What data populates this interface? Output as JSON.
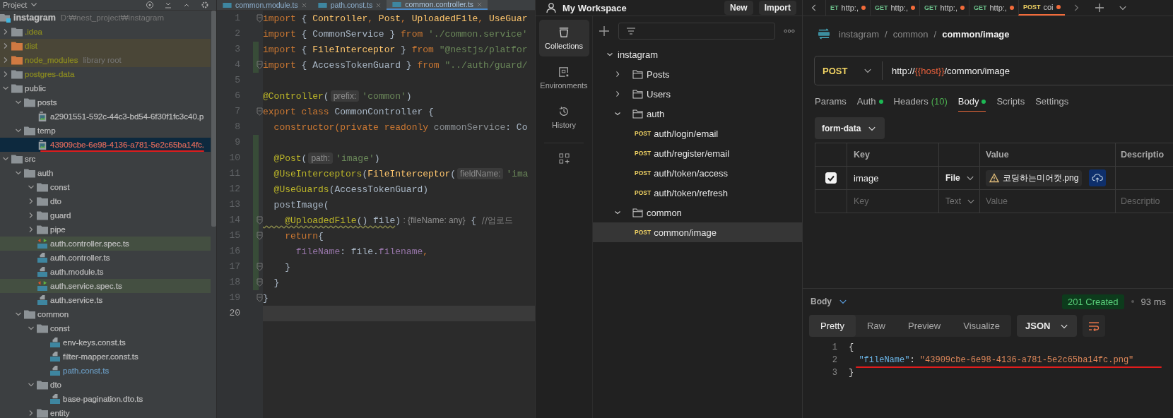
{
  "ide": {
    "project_header": {
      "title": "Project"
    },
    "tree": [
      {
        "name": "instagram",
        "hint": "D:₩nest_project₩instagram",
        "kind": "root",
        "color": "#bbbbbb",
        "selected": false,
        "children": [
          {
            "name": ".idea",
            "kind": "folder",
            "expanded": false,
            "color": "#8b8b21",
            "selected": false
          },
          {
            "name": "dist",
            "kind": "excluded-folder",
            "expanded": false,
            "color": "#8b8b21",
            "selected": false
          },
          {
            "name": "node_modules",
            "hint": "library root",
            "kind": "excluded-folder",
            "expanded": false,
            "color": "#8b8b21",
            "selected": false
          },
          {
            "name": "postgres-data",
            "kind": "folder",
            "expanded": false,
            "color": "#8b8b21",
            "selected": false
          },
          {
            "name": "public",
            "kind": "folder",
            "expanded": true,
            "color": "#bbbbbb",
            "selected": false,
            "children": [
              {
                "name": "posts",
                "kind": "folder",
                "expanded": true,
                "color": "#bbbbbb",
                "selected": false,
                "children": [
                  {
                    "name": "a2901551-592c-44c3-bd54-6f30f1fc3c40.p",
                    "kind": "image-file",
                    "color": "#bbbbbb",
                    "selected": false
                  }
                ]
              },
              {
                "name": "temp",
                "kind": "folder",
                "expanded": true,
                "color": "#bbbbbb",
                "selected": false,
                "children": [
                  {
                    "name": "43909cbe-6e98-4136-a781-5e2c65ba14fc.",
                    "kind": "image-file",
                    "color": "#d8695b",
                    "selected": true,
                    "underlined": true
                  }
                ]
              }
            ]
          },
          {
            "name": "src",
            "kind": "folder",
            "expanded": true,
            "color": "#bbbbbb",
            "selected": false,
            "children": [
              {
                "name": "auth",
                "kind": "folder",
                "expanded": true,
                "color": "#bbbbbb",
                "selected": false,
                "children": [
                  {
                    "name": "const",
                    "kind": "folder",
                    "expanded": true,
                    "color": "#bbbbbb",
                    "selected": false
                  },
                  {
                    "name": "dto",
                    "kind": "folder",
                    "expanded": false,
                    "color": "#bbbbbb",
                    "selected": false
                  },
                  {
                    "name": "guard",
                    "kind": "folder",
                    "expanded": false,
                    "color": "#bbbbbb",
                    "selected": false
                  },
                  {
                    "name": "pipe",
                    "kind": "folder",
                    "expanded": false,
                    "color": "#bbbbbb",
                    "selected": false
                  },
                  {
                    "name": "auth.controller.spec.ts",
                    "kind": "test-file",
                    "color": "#bbbbbb",
                    "selected": false
                  },
                  {
                    "name": "auth.controller.ts",
                    "kind": "ts-file",
                    "color": "#bbbbbb",
                    "selected": false
                  },
                  {
                    "name": "auth.module.ts",
                    "kind": "ts-file",
                    "color": "#bbbbbb",
                    "selected": false
                  },
                  {
                    "name": "auth.service.spec.ts",
                    "kind": "test-file",
                    "color": "#bbbbbb",
                    "selected": false
                  },
                  {
                    "name": "auth.service.ts",
                    "kind": "ts-file",
                    "color": "#bbbbbb",
                    "selected": false
                  }
                ]
              },
              {
                "name": "common",
                "kind": "folder",
                "expanded": true,
                "color": "#bbbbbb",
                "selected": false,
                "children": [
                  {
                    "name": "const",
                    "kind": "folder",
                    "expanded": true,
                    "color": "#bbbbbb",
                    "selected": false,
                    "children": [
                      {
                        "name": "env-keys.const.ts",
                        "kind": "ts-file",
                        "color": "#bbbbbb",
                        "selected": false
                      },
                      {
                        "name": "filter-mapper.const.ts",
                        "kind": "ts-file",
                        "color": "#bbbbbb",
                        "selected": false
                      },
                      {
                        "name": "path.const.ts",
                        "kind": "ts-file",
                        "color": "#6897bb",
                        "selected": false
                      }
                    ]
                  },
                  {
                    "name": "dto",
                    "kind": "folder",
                    "expanded": true,
                    "color": "#bbbbbb",
                    "selected": false,
                    "children": [
                      {
                        "name": "base-pagination.dto.ts",
                        "kind": "ts-file",
                        "color": "#bbbbbb",
                        "selected": false
                      }
                    ]
                  },
                  {
                    "name": "entity",
                    "kind": "folder",
                    "expanded": false,
                    "color": "#bbbbbb",
                    "selected": false
                  }
                ]
              }
            ]
          }
        ]
      }
    ],
    "editor_tabs": [
      {
        "label": "common.module.ts",
        "selected": false
      },
      {
        "label": "path.const.ts",
        "selected": false
      },
      {
        "label": "common.controller.ts",
        "selected": true
      }
    ],
    "code_lines": [
      {
        "number": "1",
        "changed": false,
        "fold": true,
        "current": false,
        "tokens": [
          {
            "text": "import",
            "kind": "kw"
          },
          {
            "text": " { ",
            "kind": "name"
          },
          {
            "text": "Controller",
            "kind": "fn"
          },
          {
            "text": ", ",
            "kind": "kw"
          },
          {
            "text": "Post",
            "kind": "fn"
          },
          {
            "text": ", ",
            "kind": "kw"
          },
          {
            "text": "UploadedFile",
            "kind": "fn"
          },
          {
            "text": ", ",
            "kind": "kw"
          },
          {
            "text": "UseGuar",
            "kind": "fn"
          }
        ]
      },
      {
        "number": "2",
        "changed": false,
        "fold": false,
        "current": false,
        "tokens": [
          {
            "text": "import",
            "kind": "kw"
          },
          {
            "text": " { CommonService } ",
            "kind": "name"
          },
          {
            "text": "from",
            "kind": "kw"
          },
          {
            "text": " './common.service'",
            "kind": "str"
          }
        ]
      },
      {
        "number": "3",
        "changed": true,
        "fold": false,
        "current": false,
        "tokens": [
          {
            "text": "import",
            "kind": "kw"
          },
          {
            "text": " { ",
            "kind": "name"
          },
          {
            "text": "FileInterceptor",
            "kind": "fn"
          },
          {
            "text": " } ",
            "kind": "name"
          },
          {
            "text": "from",
            "kind": "kw"
          },
          {
            "text": " \"@nestjs/platfor",
            "kind": "str"
          }
        ]
      },
      {
        "number": "4",
        "changed": true,
        "fold": true,
        "current": false,
        "tokens": [
          {
            "text": "import",
            "kind": "kw"
          },
          {
            "text": " { AccessTokenGuard } ",
            "kind": "name"
          },
          {
            "text": "from",
            "kind": "kw"
          },
          {
            "text": " \"../auth/guard/",
            "kind": "str"
          }
        ]
      },
      {
        "number": "5",
        "changed": false,
        "fold": false,
        "current": false
      },
      {
        "number": "6",
        "changed": false,
        "fold": false,
        "current": false,
        "tokens": [
          {
            "text": "@Controller",
            "kind": "deco"
          },
          {
            "text": "(",
            "kind": "name"
          },
          {
            "text": "prefix:",
            "kind": "hint"
          },
          {
            "text": "'common'",
            "kind": "str"
          },
          {
            "text": ")",
            "kind": "name"
          }
        ]
      },
      {
        "number": "7",
        "changed": false,
        "fold": true,
        "current": false,
        "tokens": [
          {
            "text": "export class",
            "kind": "kw"
          },
          {
            "text": " CommonController {",
            "kind": "name"
          }
        ]
      },
      {
        "number": "8",
        "changed": false,
        "fold": false,
        "current": false,
        "tokens": [
          {
            "text": "  constructor(private readonly ",
            "kind": "kw"
          },
          {
            "text": "commonService",
            "kind": "unused"
          },
          {
            "text": ": Co",
            "kind": "name"
          }
        ]
      },
      {
        "number": "9",
        "changed": true,
        "fold": false,
        "current": false
      },
      {
        "number": "10",
        "changed": true,
        "fold": false,
        "current": false,
        "tokens": [
          {
            "text": "  @Post",
            "kind": "deco"
          },
          {
            "text": "(",
            "kind": "name"
          },
          {
            "text": "path:",
            "kind": "hint"
          },
          {
            "text": "'image'",
            "kind": "str"
          },
          {
            "text": ")",
            "kind": "name"
          }
        ]
      },
      {
        "number": "11",
        "changed": true,
        "fold": false,
        "current": false,
        "tokens": [
          {
            "text": "  @UseInterceptors",
            "kind": "deco"
          },
          {
            "text": "(",
            "kind": "name"
          },
          {
            "text": "FileInterceptor",
            "kind": "fn"
          },
          {
            "text": "(",
            "kind": "name"
          },
          {
            "text": "fieldName:",
            "kind": "hint"
          },
          {
            "text": "'ima",
            "kind": "str"
          }
        ]
      },
      {
        "number": "12",
        "changed": true,
        "fold": false,
        "current": false,
        "tokens": [
          {
            "text": "  @UseGuards",
            "kind": "deco"
          },
          {
            "text": "(AccessTokenGuard)",
            "kind": "name"
          }
        ]
      },
      {
        "number": "13",
        "changed": true,
        "fold": false,
        "current": false,
        "tokens": [
          {
            "text": "  postImage(",
            "kind": "name"
          }
        ]
      },
      {
        "number": "14",
        "changed": true,
        "fold": true,
        "current": false,
        "tokens": [
          {
            "text": "    @UploadedFile",
            "kind": "deco",
            "squiggly": true
          },
          {
            "text": "() file",
            "kind": "name",
            "squiggly": true
          },
          {
            "text": ")",
            "kind": "name"
          },
          {
            "text": " : {fileName: any}",
            "kind": "note"
          },
          {
            "text": " { ",
            "kind": "name"
          },
          {
            "text": "//업로드",
            "kind": "comment"
          }
        ]
      },
      {
        "number": "15",
        "changed": true,
        "fold": true,
        "current": false,
        "tokens": [
          {
            "text": "    return",
            "kind": "kw"
          },
          {
            "text": "{",
            "kind": "name"
          }
        ]
      },
      {
        "number": "16",
        "changed": true,
        "fold": false,
        "current": false,
        "tokens": [
          {
            "text": "      fileName",
            "kind": "prop"
          },
          {
            "text": ": file.",
            "kind": "name"
          },
          {
            "text": "filename",
            "kind": "prop"
          },
          {
            "text": ",",
            "kind": "kw"
          }
        ]
      },
      {
        "number": "17",
        "changed": true,
        "fold": true,
        "current": false,
        "tokens": [
          {
            "text": "    }",
            "kind": "name"
          }
        ]
      },
      {
        "number": "18",
        "changed": true,
        "fold": true,
        "current": false,
        "tokens": [
          {
            "text": "  }",
            "kind": "name"
          }
        ]
      },
      {
        "number": "19",
        "changed": false,
        "fold": true,
        "current": false,
        "tokens": [
          {
            "text": "}",
            "kind": "name"
          }
        ]
      },
      {
        "number": "20",
        "changed": false,
        "fold": false,
        "current": true
      }
    ]
  },
  "postman": {
    "workspace": {
      "title": "My Workspace",
      "buttons": [
        "New",
        "Import"
      ]
    },
    "rail": [
      {
        "label": "Collections",
        "kind": "collections",
        "selected": true
      },
      {
        "label": "Environments",
        "kind": "environments",
        "selected": false
      },
      {
        "label": "History",
        "kind": "history",
        "selected": false
      }
    ],
    "collections": [
      {
        "name": "instagram",
        "kind": "collection",
        "expanded": true,
        "selected": false,
        "children": [
          {
            "name": "Posts",
            "kind": "folder",
            "expanded": false,
            "selected": false
          },
          {
            "name": "Users",
            "kind": "folder",
            "expanded": false,
            "selected": false
          },
          {
            "name": "auth",
            "kind": "folder",
            "expanded": true,
            "selected": false,
            "children": [
              {
                "name": "auth/login/email",
                "kind": "post-request",
                "method": "POST",
                "selected": false
              },
              {
                "name": "auth/register/email",
                "kind": "post-request",
                "method": "POST",
                "selected": false
              },
              {
                "name": "auth/token/access",
                "kind": "post-request",
                "method": "POST",
                "selected": false
              },
              {
                "name": "auth/token/refresh",
                "kind": "post-request",
                "method": "POST",
                "selected": false
              }
            ]
          },
          {
            "name": "common",
            "kind": "folder",
            "expanded": true,
            "selected": false,
            "children": [
              {
                "name": "common/image",
                "kind": "post-request",
                "method": "POST",
                "selected": true
              }
            ]
          }
        ]
      }
    ],
    "tabs": [
      {
        "method": "ET",
        "kind": "get",
        "label": "http:,",
        "unsaved": true,
        "selected": false
      },
      {
        "method": "GET",
        "kind": "get",
        "label": "http:,",
        "unsaved": true,
        "selected": false
      },
      {
        "method": "GET",
        "kind": "get",
        "label": "http:,",
        "unsaved": true,
        "selected": false
      },
      {
        "method": "GET",
        "kind": "get",
        "label": "http:,",
        "unsaved": true,
        "selected": false
      },
      {
        "method": "POST",
        "kind": "post",
        "label": "coi",
        "unsaved": true,
        "selected": true
      }
    ],
    "breadcrumb": {
      "path": [
        "instagram",
        "common"
      ],
      "separator": "/",
      "current": "common/image"
    },
    "request": {
      "method": "POST",
      "kind": "post",
      "url": [
        {
          "text": "http://",
          "kind": "plain"
        },
        {
          "text": "{{host}}",
          "kind": "variable"
        },
        {
          "text": "/common/image",
          "kind": "plain"
        }
      ],
      "tabs": [
        {
          "label": "Params",
          "indicator": false,
          "selected": false
        },
        {
          "label": "Auth",
          "indicator": true,
          "selected": false
        },
        {
          "label": "Headers",
          "count": "(10)",
          "indicator": false,
          "selected": false
        },
        {
          "label": "Body",
          "indicator": true,
          "selected": true
        },
        {
          "label": "Scripts",
          "indicator": false,
          "selected": false
        },
        {
          "label": "Settings",
          "indicator": false,
          "selected": false
        }
      ],
      "body_mode": "form-data",
      "table": {
        "columns": [
          "Key",
          "Value",
          "Descriptio"
        ],
        "rows": [
          {
            "checked": true,
            "key": "image",
            "type": "File",
            "value": "코딩하는미어캣.png",
            "warning": true
          }
        ],
        "new_row": {
          "key_placeholder": "Key",
          "type": "Text",
          "value_placeholder": "Value",
          "description_placeholder": "Descriptio"
        }
      }
    },
    "response": {
      "label": "Body",
      "status": "201 Created",
      "time": "93 ms",
      "view_tabs": [
        {
          "label": "Pretty",
          "selected": true
        },
        {
          "label": "Raw",
          "selected": false
        },
        {
          "label": "Preview",
          "selected": false
        },
        {
          "label": "Visualize",
          "selected": false
        }
      ],
      "format": "JSON",
      "lines": [
        {
          "number": "1",
          "tokens": [
            {
              "text": "{",
              "kind": "punct"
            }
          ]
        },
        {
          "number": "2",
          "underlined": true,
          "tokens": [
            {
              "text": "  \"fileName\"",
              "kind": "key"
            },
            {
              "text": ": ",
              "kind": "punct"
            },
            {
              "text": "\"43909cbe-6e98-4136-a781-5e2c65ba14fc.png\"",
              "kind": "string"
            }
          ]
        },
        {
          "number": "3",
          "tokens": [
            {
              "text": "}",
              "kind": "punct"
            }
          ]
        }
      ]
    }
  }
}
